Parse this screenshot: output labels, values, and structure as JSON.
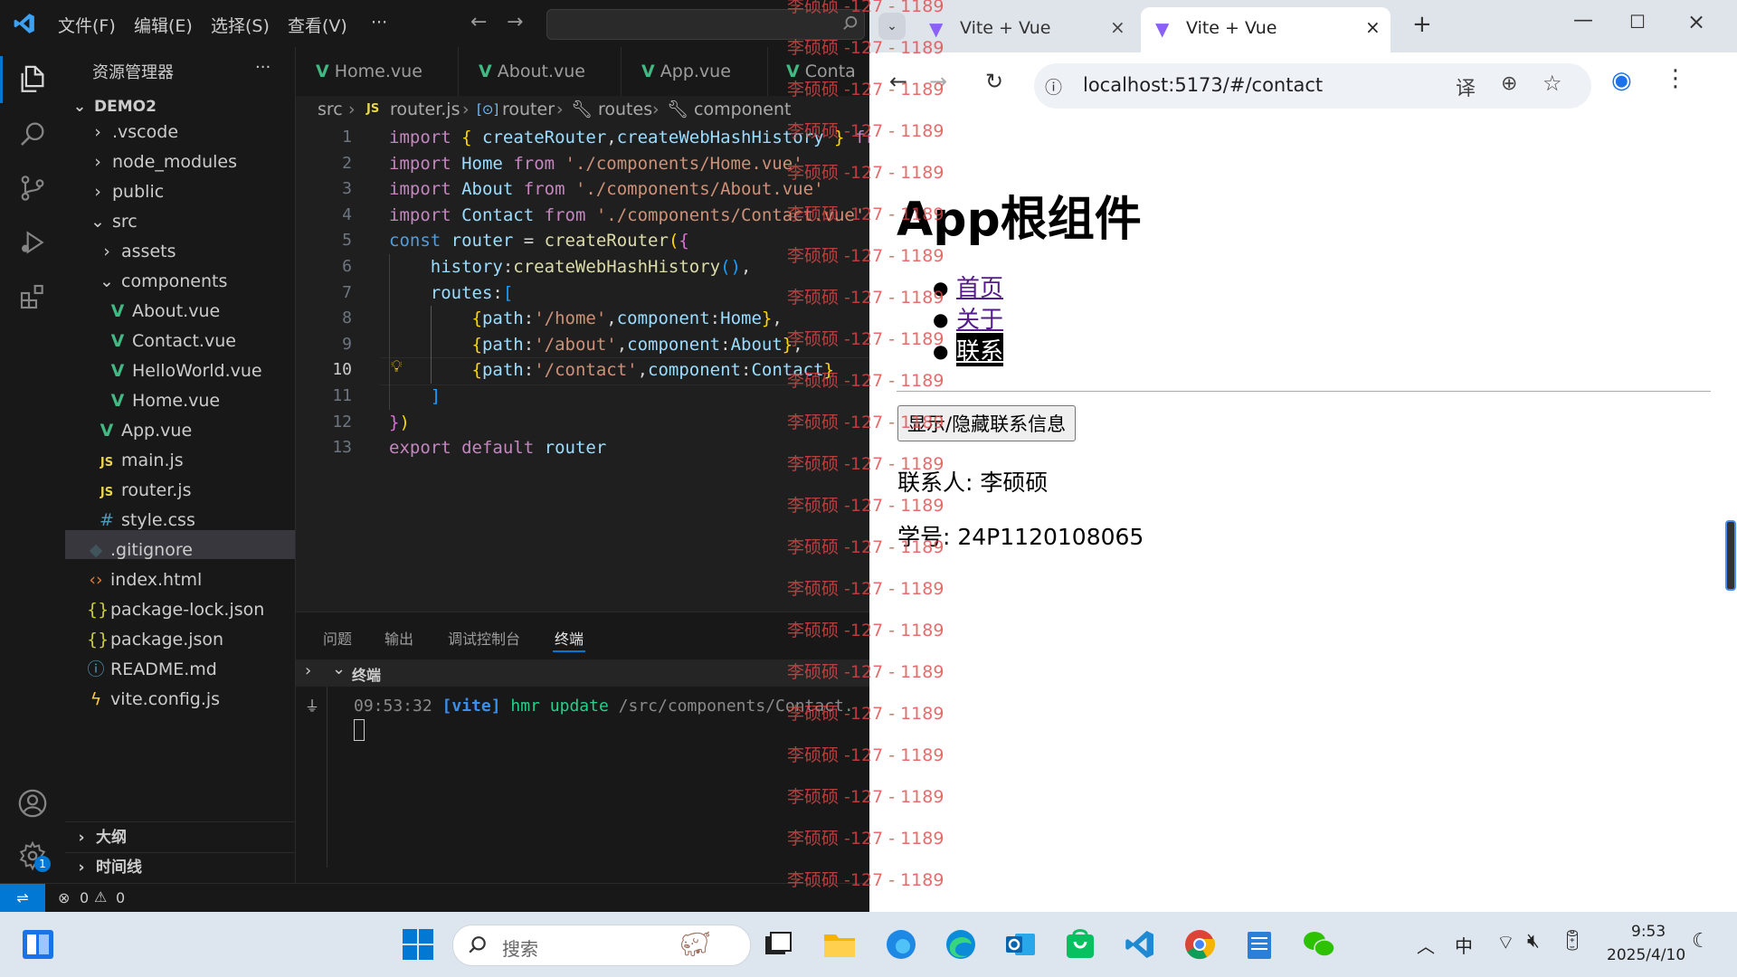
{
  "vscode": {
    "menu": [
      "文件(F)",
      "编辑(E)",
      "选择(S)",
      "查看(V)",
      "···"
    ],
    "explorer_title": "资源管理器",
    "explorer_more": "···",
    "project": "DEMO2",
    "tree": [
      ".vscode",
      "node_modules",
      "public",
      "src",
      "assets",
      "components",
      "About.vue",
      "Contact.vue",
      "HelloWorld.vue",
      "Home.vue",
      "App.vue",
      "main.js",
      "router.js",
      "style.css",
      ".gitignore",
      "index.html",
      "package-lock.json",
      "package.json",
      "README.md",
      "vite.config.js"
    ],
    "outline": "大纲",
    "timeline": "时间线",
    "tabs": [
      "Home.vue",
      "About.vue",
      "App.vue",
      "Conta"
    ],
    "breadcrumb": [
      "src",
      "router.js",
      "router",
      "routes",
      "component"
    ],
    "line_numbers": [
      "1",
      "2",
      "3",
      "4",
      "5",
      "6",
      "7",
      "8",
      "9",
      "10",
      "11",
      "12",
      "13"
    ],
    "panel_tabs": [
      "问题",
      "输出",
      "调试控制台",
      "终端"
    ],
    "terminal_title": "终端",
    "terminal_time": "09:53:32",
    "terminal_tag": "[vite]",
    "terminal_hmr": "hmr update",
    "terminal_path": "/src/components/Contact.",
    "status_errors": "0",
    "status_warnings": "0",
    "settings_badge": "1"
  },
  "browser": {
    "tabs": [
      "Vite + Vue",
      "Vite + Vue"
    ],
    "url": "localhost:5173/#/contact",
    "page": {
      "heading": "App根组件",
      "nav": [
        "首页",
        "关于",
        "联系"
      ],
      "toggle_button": "显示/隐藏联系信息",
      "contact_line": "联系人: 李硕硕",
      "id_line": "学号: 24P1120108065"
    }
  },
  "watermark": "李硕硕 -127 - 1189",
  "taskbar": {
    "search_placeholder": "搜索",
    "ime": "中",
    "time": "9:53",
    "date": "2025/4/10"
  },
  "colors": {
    "accent": "#0078d4",
    "link": "#551a8b",
    "watermark": "#e04848"
  }
}
